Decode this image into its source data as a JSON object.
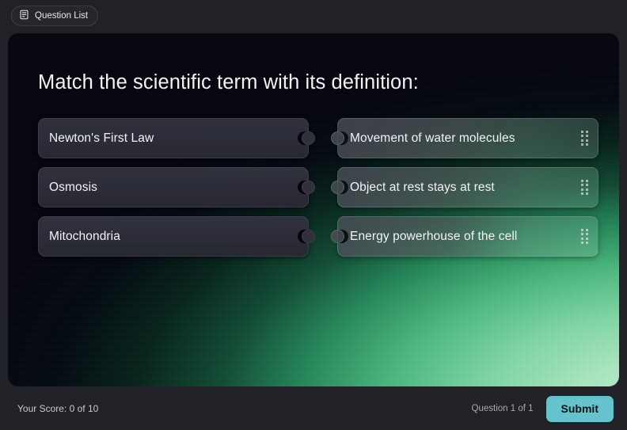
{
  "topbar": {
    "question_list_label": "Question List",
    "question_list_icon": "document-list-icon"
  },
  "quiz": {
    "title": "Match the scientific term with its definition:",
    "rows": [
      {
        "term": "Newton's First Law",
        "definition": "Movement of water molecules"
      },
      {
        "term": "Osmosis",
        "definition": "Object at rest stays at rest"
      },
      {
        "term": "Mitochondria",
        "definition": "Energy powerhouse of the cell"
      }
    ]
  },
  "footer": {
    "score_label": "Your Score: 0 of 10",
    "question_counter": "Question 1 of 1",
    "submit_label": "Submit"
  },
  "colors": {
    "page_background": "#212227",
    "panel_background": "#05050d",
    "glow_green": "#a8e6bd",
    "submit_accent": "#66c3cd",
    "term_card": "#2d2e3a",
    "text_primary": "#f2f3f7"
  }
}
